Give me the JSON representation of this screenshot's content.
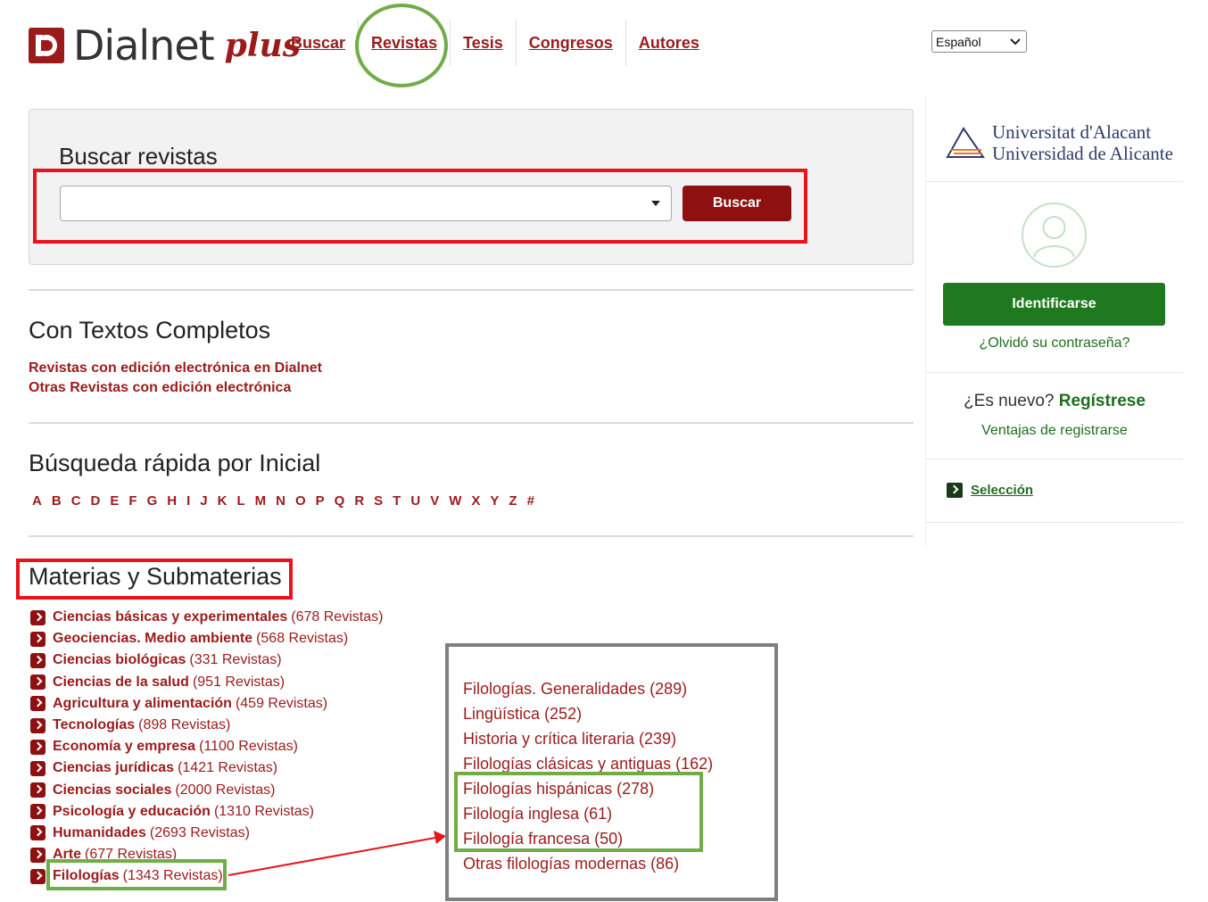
{
  "brand": {
    "name": "Dialnet",
    "plus": "plus"
  },
  "nav": [
    {
      "label": "Buscar"
    },
    {
      "label": "Revistas"
    },
    {
      "label": "Tesis"
    },
    {
      "label": "Congresos"
    },
    {
      "label": "Autores"
    }
  ],
  "language": {
    "selected": "Español"
  },
  "search": {
    "title": "Buscar revistas",
    "value": "",
    "button": "Buscar"
  },
  "full_text": {
    "title": "Con Textos Completos",
    "links": [
      "Revistas con edición electrónica en Dialnet",
      "Otras Revistas con edición electrónica"
    ]
  },
  "quick": {
    "title": "Búsqueda rápida por Inicial",
    "letters": [
      "A",
      "B",
      "C",
      "D",
      "E",
      "F",
      "G",
      "H",
      "I",
      "J",
      "K",
      "L",
      "M",
      "N",
      "O",
      "P",
      "Q",
      "R",
      "S",
      "T",
      "U",
      "V",
      "W",
      "X",
      "Y",
      "Z",
      "#"
    ]
  },
  "materias": {
    "title": "Materias y Submaterias",
    "items": [
      {
        "name": "Ciencias básicas y experimentales",
        "count": "(678 Revistas)"
      },
      {
        "name": "Geociencias. Medio ambiente",
        "count": "(568 Revistas)"
      },
      {
        "name": "Ciencias biológicas",
        "count": "(331 Revistas)"
      },
      {
        "name": "Ciencias de la salud",
        "count": "(951 Revistas)"
      },
      {
        "name": "Agricultura y alimentación",
        "count": "(459 Revistas)"
      },
      {
        "name": "Tecnologías",
        "count": "(898 Revistas)"
      },
      {
        "name": "Economía y empresa",
        "count": "(1100 Revistas)"
      },
      {
        "name": "Ciencias jurídicas",
        "count": "(1421 Revistas)"
      },
      {
        "name": "Ciencias sociales",
        "count": "(2000 Revistas)"
      },
      {
        "name": "Psicología y educación",
        "count": "(1310 Revistas)"
      },
      {
        "name": "Humanidades",
        "count": "(2693 Revistas)"
      },
      {
        "name": "Arte",
        "count": "(677 Revistas)"
      },
      {
        "name": "Filologías",
        "count": "(1343 Revistas)"
      }
    ]
  },
  "submaterias": [
    "Filologías. Generalidades (289)",
    "Lingüística (252)",
    "Historia y crítica literaria (239)",
    "Filologías clásicas y antiguas (162)",
    "Filologías hispánicas (278)",
    "Filología inglesa (61)",
    "Filología francesa (50)",
    "Otras filologías modernas (86)"
  ],
  "sidebar": {
    "university_line1": "Universitat d'Alacant",
    "university_line2": "Universidad de Alicante",
    "login_button": "Identificarse",
    "forgot": "¿Olvidó su contraseña?",
    "new_prefix": "¿Es nuevo?",
    "register": "Regístrese",
    "benefits": "Ventajas de registrarse",
    "selection": "Selección"
  },
  "colors": {
    "brand_red": "#8e1010",
    "green": "#1f7a1f",
    "annotation_red": "#e8141b",
    "annotation_green": "#70ad47"
  }
}
